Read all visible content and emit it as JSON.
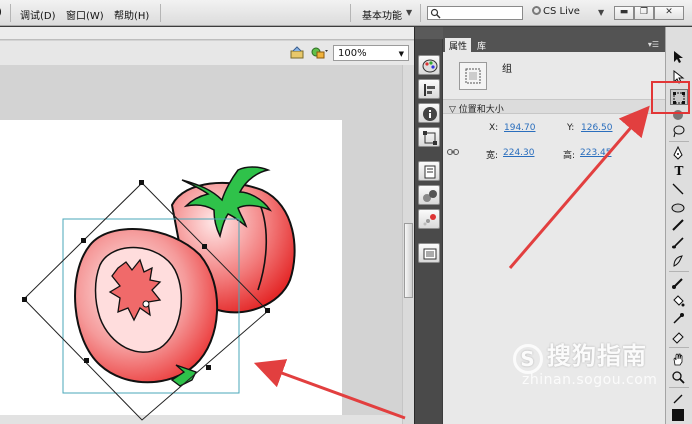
{
  "menubar": {
    "items": [
      "调试(D)",
      "窗口(W)",
      "帮助(H)"
    ],
    "workspace": "基本功能",
    "search_placeholder": "",
    "cs_live": "CS Live"
  },
  "stage": {
    "zoom": "100%"
  },
  "panel": {
    "tabs": [
      "属性",
      "库"
    ],
    "instance_type": "组",
    "section_title": "位置和大小",
    "x_label": "X:",
    "x_value": "194.70",
    "y_label": "Y:",
    "y_value": "126.50",
    "w_label": "宽:",
    "w_value": "224.30",
    "h_label": "高:",
    "h_value": "223.45"
  },
  "toolbar": {
    "tools": [
      "selection-tool",
      "subselection-tool",
      "free-transform-tool",
      "3d-rotation-tool",
      "lasso-tool",
      "pen-tool",
      "text-tool",
      "line-tool",
      "oval-tool",
      "pencil-tool",
      "brush-tool",
      "deco-tool",
      "bone-tool",
      "paint-bucket-tool",
      "eyedropper-tool",
      "eraser-tool",
      "hand-tool",
      "zoom-tool",
      "stroke-color",
      "fill-color"
    ]
  },
  "watermark": {
    "logo": "S",
    "text": "搜狗指南",
    "sub": "zhinan.sogou.com"
  },
  "colors": {
    "highlight": "#e23636",
    "arrow": "#e23f3f",
    "tomato": "#ef3b3b",
    "leaf": "#2fc24a"
  }
}
